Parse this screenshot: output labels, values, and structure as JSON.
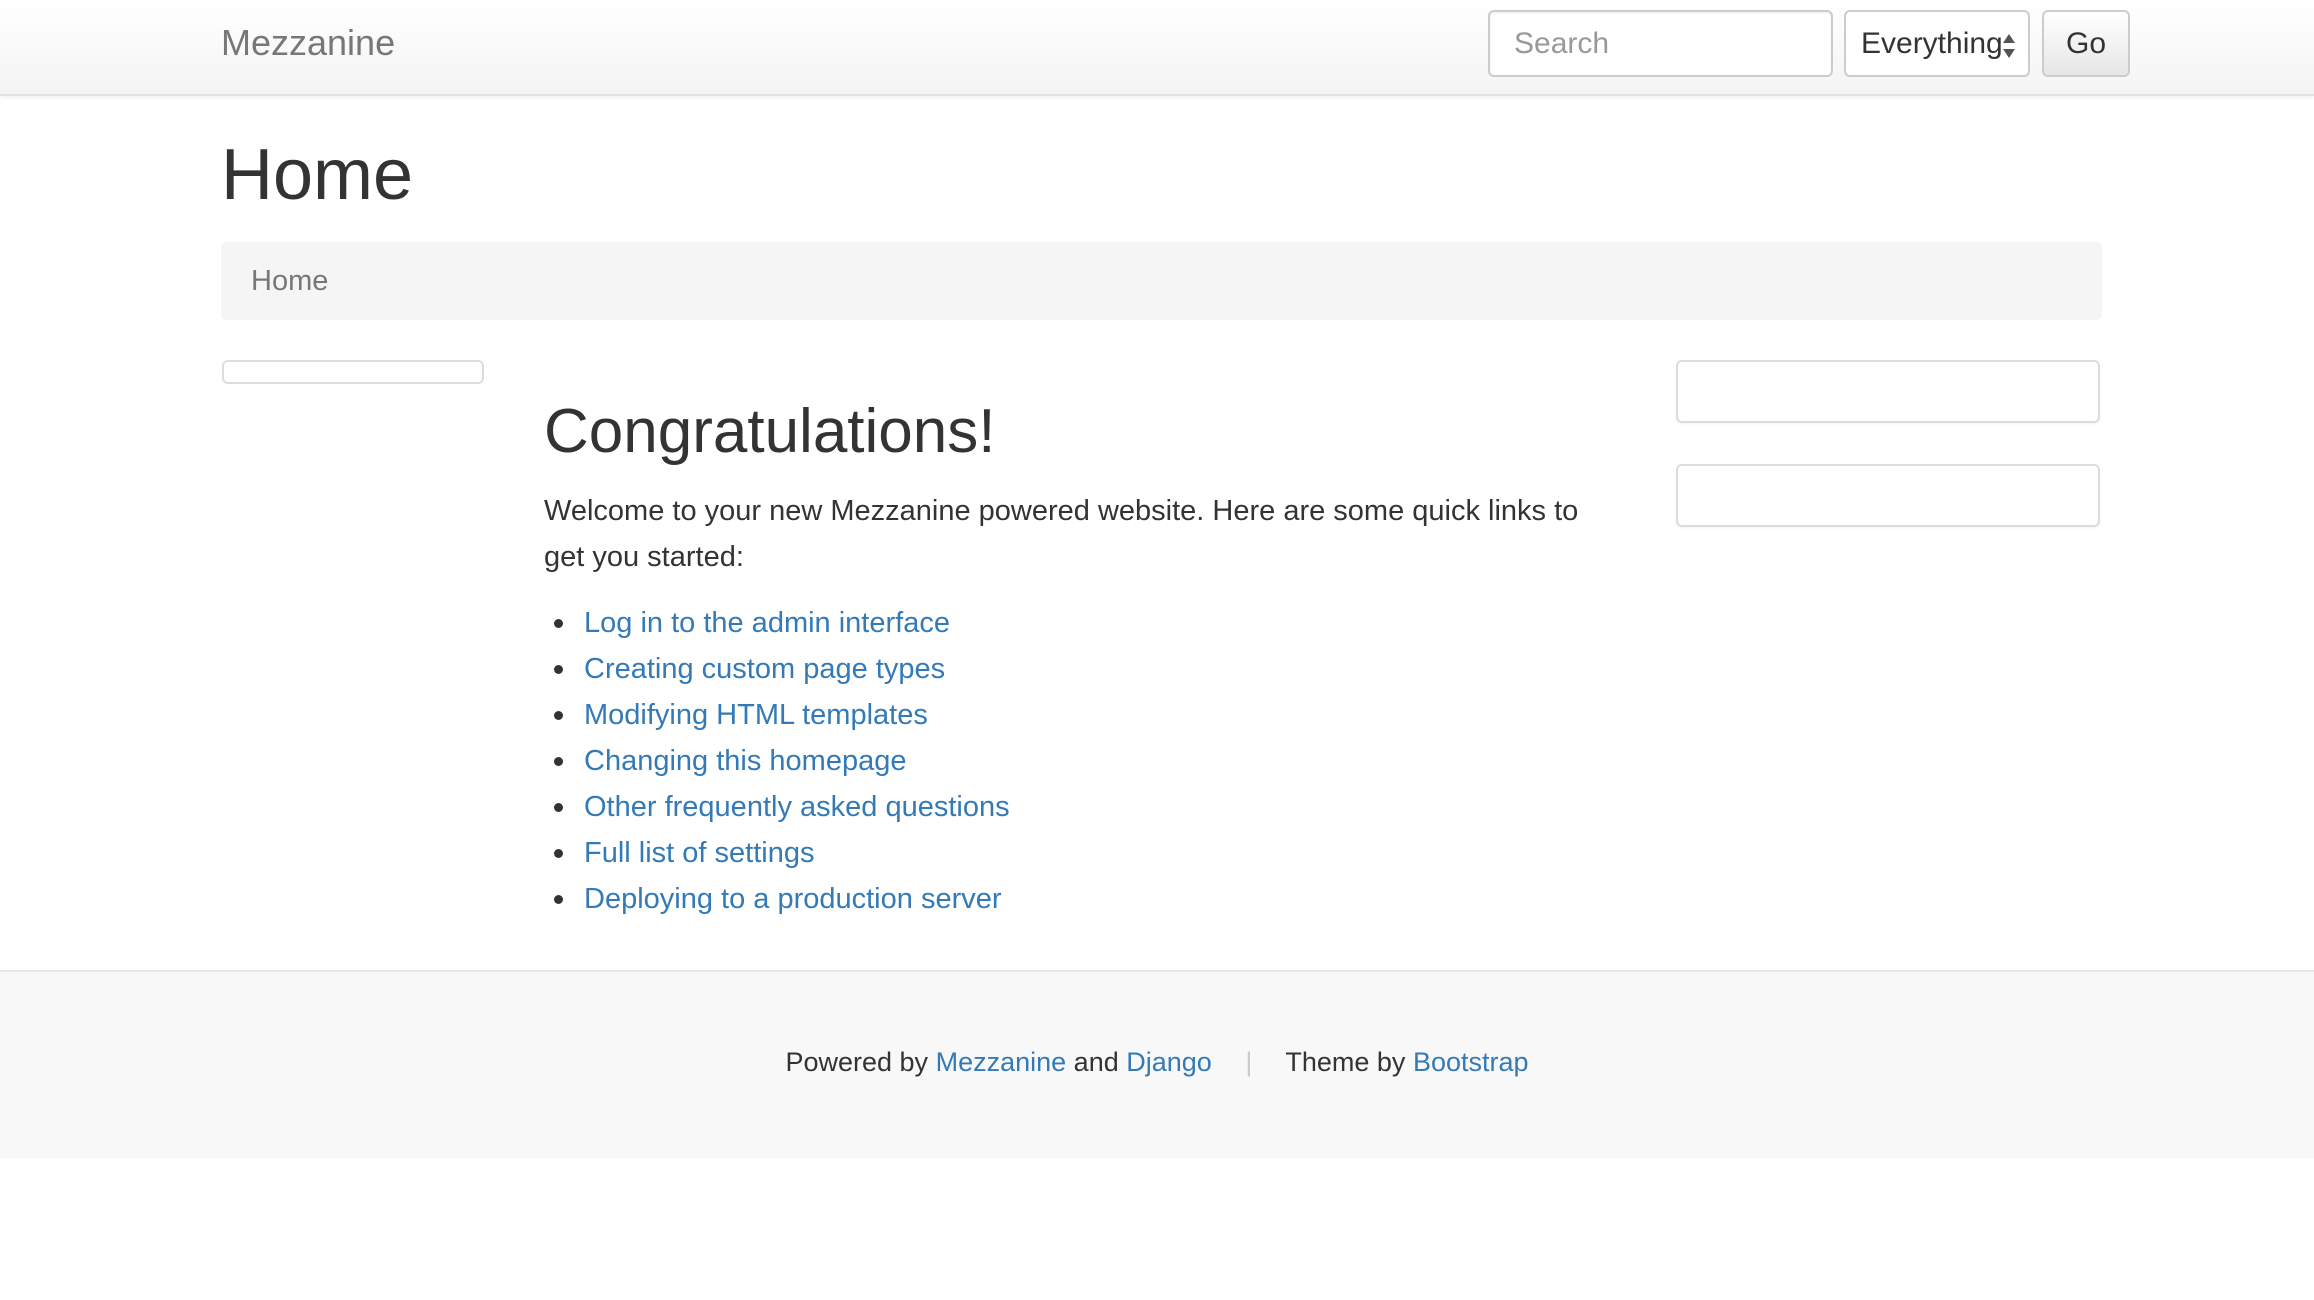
{
  "navbar": {
    "brand": "Mezzanine",
    "search_placeholder": "Search",
    "search_scope": "Everything",
    "go_label": "Go"
  },
  "page": {
    "title": "Home",
    "breadcrumb": [
      "Home"
    ]
  },
  "main": {
    "heading": "Congratulations!",
    "intro": "Welcome to your new Mezzanine powered website. Here are some quick links to get you started:",
    "links": [
      "Log in to the admin interface",
      "Creating custom page types",
      "Modifying HTML templates",
      "Changing this homepage",
      "Other frequently asked questions",
      "Full list of settings",
      "Deploying to a production server"
    ]
  },
  "footer": {
    "powered_by": "Powered by",
    "mezzanine_link": "Mezzanine",
    "and": "and",
    "django_link": "Django",
    "separator": "|",
    "theme_by": "Theme by",
    "bootstrap_link": "Bootstrap"
  },
  "colors": {
    "link": "#337ab7",
    "text": "#333333",
    "muted": "#777777"
  },
  "icons": {
    "select_arrows": "up-down-arrows-icon"
  }
}
